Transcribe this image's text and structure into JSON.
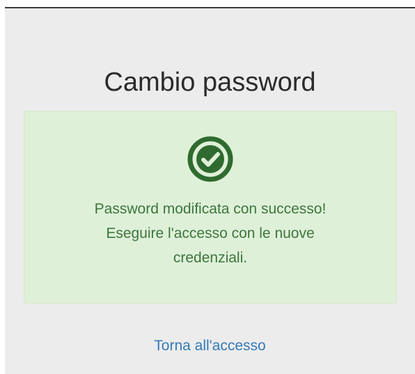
{
  "page": {
    "title": "Cambio password"
  },
  "alert": {
    "icon": "check-circle-icon",
    "line1": "Password modificata con successo!",
    "line2": "Eseguire l'accesso con le nuove",
    "line3": "credenziali.",
    "colors": {
      "background": "#dff0d8",
      "text": "#3c763d",
      "icon": "#2f6b2f"
    }
  },
  "link": {
    "back_label": "Torna all'accesso",
    "color": "#337ab7"
  }
}
